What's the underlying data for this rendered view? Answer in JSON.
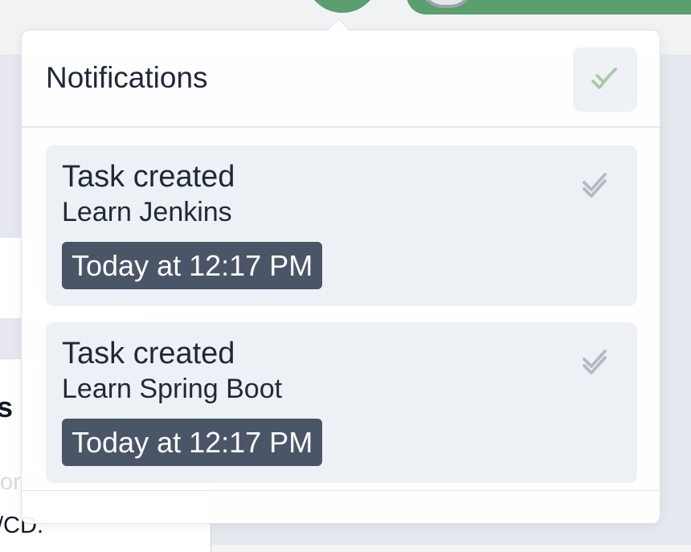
{
  "background": {
    "heading_fragment": "s",
    "text_fragment_1": "ormation",
    "text_fragment_2": "/CD."
  },
  "notifications": {
    "title": "Notifications",
    "mark_all_icon": "double-check-icon",
    "items": [
      {
        "title": "Task created",
        "detail": "Learn Jenkins",
        "time": "Today at 12:17 PM",
        "icon": "double-check-icon"
      },
      {
        "title": "Task created",
        "detail": "Learn Spring Boot",
        "time": "Today at 12:17 PM",
        "icon": "double-check-icon"
      }
    ]
  },
  "colors": {
    "accent_green": "#5a9f6d",
    "mark_all_check": "#a8c9a2",
    "item_check": "#b4b9c2",
    "time_badge": "#4a5568",
    "card_bg": "#edf0f5"
  }
}
